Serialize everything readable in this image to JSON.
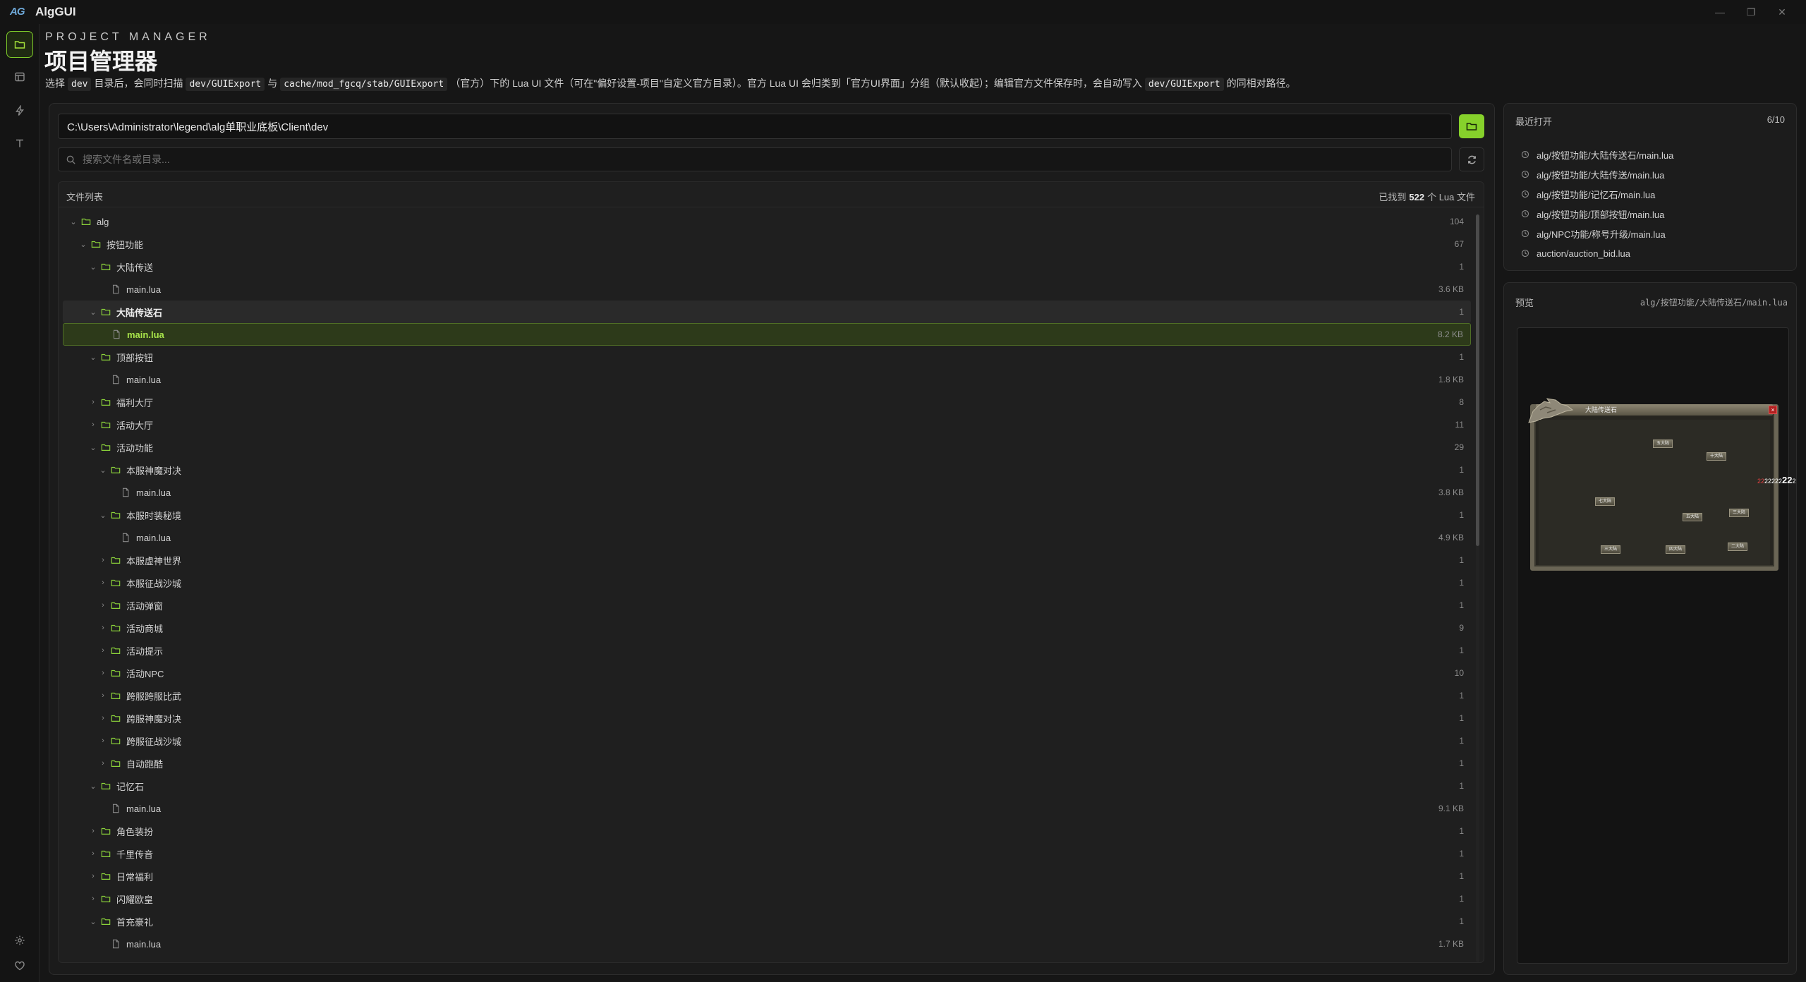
{
  "app": {
    "title": "AlgGUI",
    "logo_text": "AG"
  },
  "window_controls": {
    "minimize": "—",
    "restore": "❐",
    "close": "✕"
  },
  "header": {
    "eyebrow": "PROJECT MANAGER",
    "title": "项目管理器",
    "description": {
      "p1": "选择",
      "c1": "dev",
      "p2": "目录后，会同时扫描",
      "c2": "dev/GUIExport",
      "p3": "与",
      "c3": "cache/mod_fgcq/stab/GUIExport",
      "p4": "（官方）下的 Lua UI 文件（可在\"偏好设置-项目\"自定义官方目录）。官方 Lua UI 会归类到「官方UI界面」分组（默认收起）；编辑官方文件保存时，会自动写入",
      "c4": "dev/GUIExport",
      "p5": "的同相对路径。"
    }
  },
  "path_input": {
    "value": "C:\\Users\\Administrator\\legend\\alg单职业底板\\Client\\dev"
  },
  "search": {
    "placeholder": "搜索文件名或目录..."
  },
  "file_list": {
    "title": "文件列表",
    "count_prefix": "已找到",
    "count": "522",
    "count_suffix": "个 Lua 文件",
    "rows": [
      {
        "depth": 0,
        "type": "folder",
        "open": true,
        "name": "alg",
        "meta": "104"
      },
      {
        "depth": 1,
        "type": "folder",
        "open": true,
        "name": "按钮功能",
        "meta": "67"
      },
      {
        "depth": 2,
        "type": "folder",
        "open": true,
        "name": "大陆传送",
        "meta": "1"
      },
      {
        "depth": 3,
        "type": "file",
        "name": "main.lua",
        "meta": "3.6 KB"
      },
      {
        "depth": 2,
        "type": "folder",
        "open": true,
        "name": "大陆传送石",
        "meta": "1",
        "state": "hl"
      },
      {
        "depth": 3,
        "type": "file",
        "name": "main.lua",
        "meta": "8.2 KB",
        "state": "sel"
      },
      {
        "depth": 2,
        "type": "folder",
        "open": true,
        "name": "顶部按钮",
        "meta": "1"
      },
      {
        "depth": 3,
        "type": "file",
        "name": "main.lua",
        "meta": "1.8 KB"
      },
      {
        "depth": 2,
        "type": "folder",
        "open": false,
        "name": "福利大厅",
        "meta": "8"
      },
      {
        "depth": 2,
        "type": "folder",
        "open": false,
        "name": "活动大厅",
        "meta": "11"
      },
      {
        "depth": 2,
        "type": "folder",
        "open": true,
        "name": "活动功能",
        "meta": "29"
      },
      {
        "depth": 3,
        "type": "folder",
        "open": true,
        "name": "本服神魔对决",
        "meta": "1"
      },
      {
        "depth": 4,
        "type": "file",
        "name": "main.lua",
        "meta": "3.8 KB"
      },
      {
        "depth": 3,
        "type": "folder",
        "open": true,
        "name": "本服时装秘境",
        "meta": "1"
      },
      {
        "depth": 4,
        "type": "file",
        "name": "main.lua",
        "meta": "4.9 KB"
      },
      {
        "depth": 3,
        "type": "folder",
        "open": false,
        "name": "本服虚神世界",
        "meta": "1"
      },
      {
        "depth": 3,
        "type": "folder",
        "open": false,
        "name": "本服征战沙城",
        "meta": "1"
      },
      {
        "depth": 3,
        "type": "folder",
        "open": false,
        "name": "活动弹窗",
        "meta": "1"
      },
      {
        "depth": 3,
        "type": "folder",
        "open": false,
        "name": "活动商城",
        "meta": "9"
      },
      {
        "depth": 3,
        "type": "folder",
        "open": false,
        "name": "活动提示",
        "meta": "1"
      },
      {
        "depth": 3,
        "type": "folder",
        "open": false,
        "name": "活动NPC",
        "meta": "10"
      },
      {
        "depth": 3,
        "type": "folder",
        "open": false,
        "name": "跨服跨服比武",
        "meta": "1"
      },
      {
        "depth": 3,
        "type": "folder",
        "open": false,
        "name": "跨服神魔对决",
        "meta": "1"
      },
      {
        "depth": 3,
        "type": "folder",
        "open": false,
        "name": "跨服征战沙城",
        "meta": "1"
      },
      {
        "depth": 3,
        "type": "folder",
        "open": false,
        "name": "自动跑酷",
        "meta": "1"
      },
      {
        "depth": 2,
        "type": "folder",
        "open": true,
        "name": "记忆石",
        "meta": "1"
      },
      {
        "depth": 3,
        "type": "file",
        "name": "main.lua",
        "meta": "9.1 KB"
      },
      {
        "depth": 2,
        "type": "folder",
        "open": false,
        "name": "角色装扮",
        "meta": "1"
      },
      {
        "depth": 2,
        "type": "folder",
        "open": false,
        "name": "千里传音",
        "meta": "1"
      },
      {
        "depth": 2,
        "type": "folder",
        "open": false,
        "name": "日常福利",
        "meta": "1"
      },
      {
        "depth": 2,
        "type": "folder",
        "open": false,
        "name": "闪耀欧皇",
        "meta": "1"
      },
      {
        "depth": 2,
        "type": "folder",
        "open": true,
        "name": "首充豪礼",
        "meta": "1"
      },
      {
        "depth": 3,
        "type": "file",
        "name": "main.lua",
        "meta": "1.7 KB"
      }
    ]
  },
  "recent": {
    "title": "最近打开",
    "count": "6/10",
    "items": [
      "alg/按钮功能/大陆传送石/main.lua",
      "alg/按钮功能/大陆传送/main.lua",
      "alg/按钮功能/记忆石/main.lua",
      "alg/按钮功能/顶部按钮/main.lua",
      "alg/NPC功能/称号升级/main.lua",
      "auction/auction_bid.lua"
    ]
  },
  "preview": {
    "title": "预览",
    "path": "alg/按钮功能/大陆传送石/main.lua",
    "game": {
      "title": "大陆传送石",
      "close": "×",
      "number_red": "22",
      "number_mid": "22222",
      "number_big": "22",
      "number_end": "2",
      "buttons": [
        "五大陆",
        "十大陆",
        "七大陆",
        "五大陆",
        "三大陆",
        "三大陆",
        "四大陆",
        "二大陆"
      ]
    }
  },
  "colors": {
    "accent": "#86d12b",
    "selected_bg": "#2d3a1a",
    "background": "#161616"
  }
}
